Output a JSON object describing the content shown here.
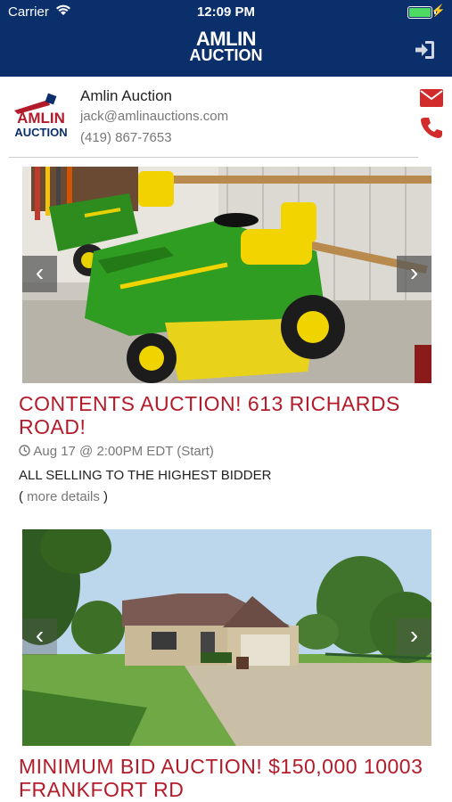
{
  "status_bar": {
    "carrier": "Carrier",
    "time": "12:09 PM"
  },
  "header": {
    "logo_line1": "AMLIN",
    "logo_line2": "AUCTION"
  },
  "company": {
    "logo_line1": "AMLIN",
    "logo_line2": "AUCTION",
    "name": "Amlin Auction",
    "email": "jack@amlinauctions.com",
    "phone": "(419) 867-7653"
  },
  "listings": [
    {
      "title": "CONTENTS AUCTION! 613 RICHARDS ROAD!",
      "date": "Aug 17 @ 2:00PM EDT (Start)",
      "description": "ALL SELLING TO THE HIGHEST BIDDER",
      "more_prefix": "( ",
      "more_label": "more details",
      "more_suffix": " )"
    },
    {
      "title": "MINIMUM BID AUCTION! $150,000 10003 FRANKFORT RD"
    }
  ],
  "colors": {
    "brand_navy": "#0b2f6b",
    "title_red": "#b31b2a"
  },
  "icons": [
    "wifi-icon",
    "battery-icon",
    "login-icon",
    "mail-icon",
    "phone-icon",
    "clock-icon",
    "chevron-left-icon",
    "chevron-right-icon"
  ]
}
